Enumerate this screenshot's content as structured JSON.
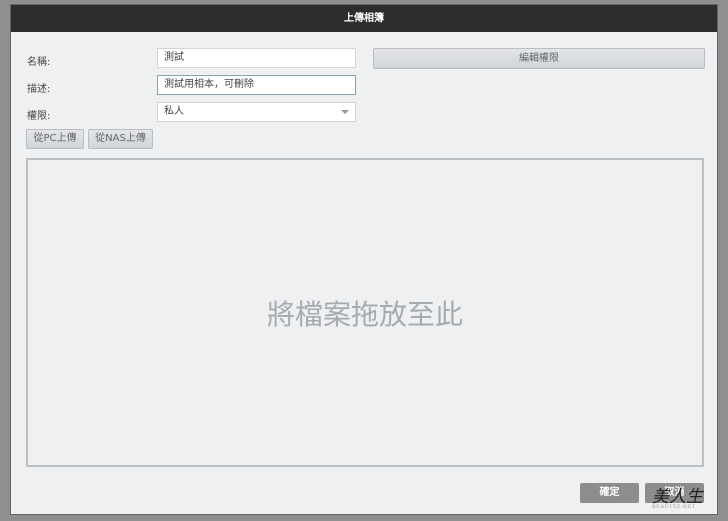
{
  "dialog": {
    "title": "上傳相簿"
  },
  "form": {
    "name_label": "名稱:",
    "name_value": "測試",
    "desc_label": "描述:",
    "desc_value": "測試用相本，可刪除",
    "perm_label": "權限:",
    "perm_value": "私人",
    "edit_perm_button": "編輯權限"
  },
  "upload": {
    "from_pc": "從PC上傳",
    "from_nas": "從NAS上傳"
  },
  "dropzone": {
    "text": "將檔案拖放至此"
  },
  "footer": {
    "ok": "確定",
    "cancel": "取消"
  },
  "watermark": {
    "text": "美人生",
    "sub": "BEAUTYZ.NET"
  }
}
